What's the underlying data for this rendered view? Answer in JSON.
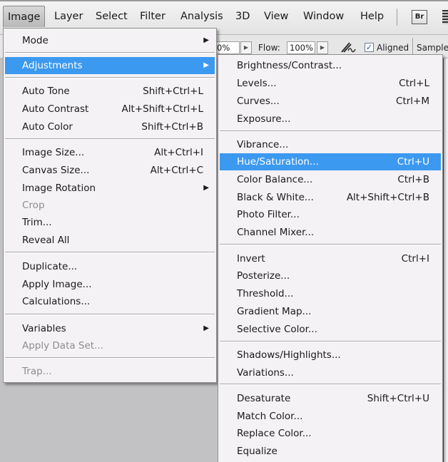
{
  "menubar": {
    "items": [
      "Image",
      "Layer",
      "Select",
      "Filter",
      "Analysis",
      "3D",
      "View",
      "Window",
      "Help"
    ],
    "active": "Image",
    "bridge_button": "Br"
  },
  "options_bar": {
    "opacity_value": "0%",
    "flow_label": "Flow:",
    "flow_value": "100%",
    "aligned_label": "Aligned",
    "aligned_checked": true,
    "sample_label": "Sample"
  },
  "image_menu": {
    "groups": [
      [
        {
          "label": "Mode",
          "submenu": true
        }
      ],
      [
        {
          "label": "Adjustments",
          "submenu": true,
          "highlighted": true
        }
      ],
      [
        {
          "label": "Auto Tone",
          "shortcut": "Shift+Ctrl+L"
        },
        {
          "label": "Auto Contrast",
          "shortcut": "Alt+Shift+Ctrl+L"
        },
        {
          "label": "Auto Color",
          "shortcut": "Shift+Ctrl+B"
        }
      ],
      [
        {
          "label": "Image Size...",
          "shortcut": "Alt+Ctrl+I"
        },
        {
          "label": "Canvas Size...",
          "shortcut": "Alt+Ctrl+C"
        },
        {
          "label": "Image Rotation",
          "submenu": true
        },
        {
          "label": "Crop",
          "disabled": true
        },
        {
          "label": "Trim..."
        },
        {
          "label": "Reveal All"
        }
      ],
      [
        {
          "label": "Duplicate..."
        },
        {
          "label": "Apply Image..."
        },
        {
          "label": "Calculations..."
        }
      ],
      [
        {
          "label": "Variables",
          "submenu": true
        },
        {
          "label": "Apply Data Set...",
          "disabled": true
        }
      ],
      [
        {
          "label": "Trap...",
          "disabled": true
        }
      ]
    ]
  },
  "adjustments_menu": {
    "groups": [
      [
        {
          "label": "Brightness/Contrast..."
        },
        {
          "label": "Levels...",
          "shortcut": "Ctrl+L"
        },
        {
          "label": "Curves...",
          "shortcut": "Ctrl+M"
        },
        {
          "label": "Exposure..."
        }
      ],
      [
        {
          "label": "Vibrance..."
        },
        {
          "label": "Hue/Saturation...",
          "shortcut": "Ctrl+U",
          "highlighted": true
        },
        {
          "label": "Color Balance...",
          "shortcut": "Ctrl+B"
        },
        {
          "label": "Black & White...",
          "shortcut": "Alt+Shift+Ctrl+B"
        },
        {
          "label": "Photo Filter..."
        },
        {
          "label": "Channel Mixer..."
        }
      ],
      [
        {
          "label": "Invert",
          "shortcut": "Ctrl+I"
        },
        {
          "label": "Posterize..."
        },
        {
          "label": "Threshold..."
        },
        {
          "label": "Gradient Map..."
        },
        {
          "label": "Selective Color..."
        }
      ],
      [
        {
          "label": "Shadows/Highlights..."
        },
        {
          "label": "Variations..."
        }
      ],
      [
        {
          "label": "Desaturate",
          "shortcut": "Shift+Ctrl+U"
        },
        {
          "label": "Match Color..."
        },
        {
          "label": "Replace Color..."
        },
        {
          "label": "Equalize"
        }
      ]
    ]
  },
  "colors": {
    "highlight": "#3c99f0",
    "menu_bg": "#f5f2f5",
    "disabled_text": "#8d8d8d",
    "workspace": "#c2c2c4"
  }
}
